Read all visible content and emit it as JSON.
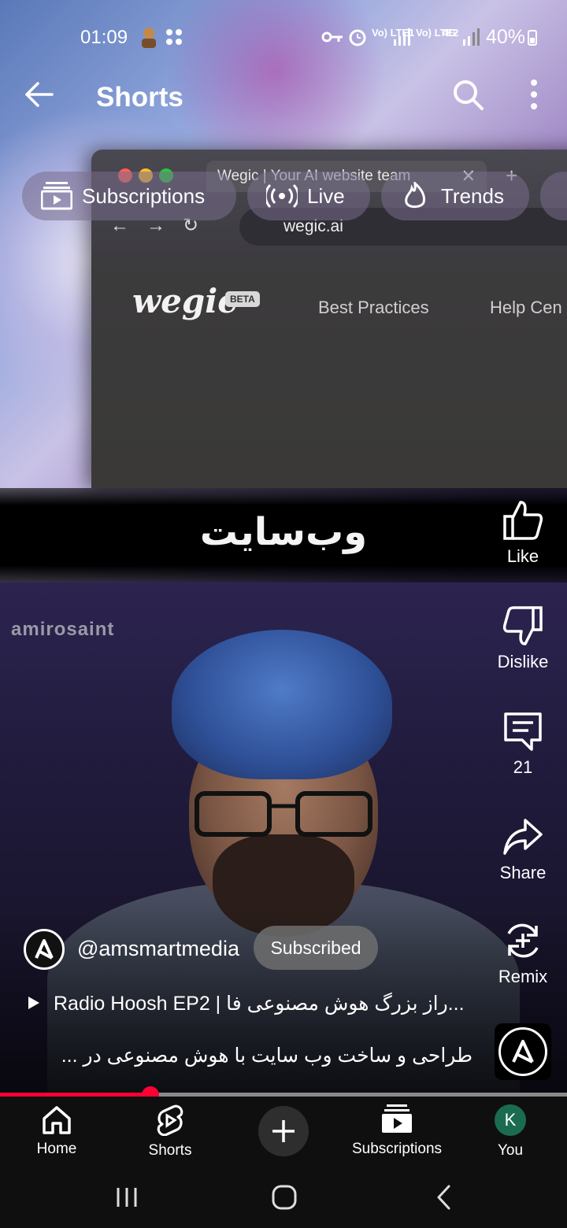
{
  "status_bar": {
    "time": "01:09",
    "network1": "Vo) LTE1",
    "network2": "Vo) LTE2",
    "network2_type": "4G",
    "battery": "40%"
  },
  "header": {
    "title": "Shorts"
  },
  "chips": [
    {
      "label": "Subscriptions",
      "icon": "subscriptions-icon"
    },
    {
      "label": "Live",
      "icon": "live-icon"
    },
    {
      "label": "Trends",
      "icon": "trends-icon"
    }
  ],
  "video": {
    "browser_tab": "Wegic | Your AI website team",
    "browser_url": "wegic.ai",
    "site_logo": "wegic",
    "site_badge": "BETA",
    "site_menu": [
      "Best Practices",
      "Help Cen"
    ],
    "caption": "وب‌سایت",
    "watermark": "amirosaint"
  },
  "actions": {
    "like": "Like",
    "dislike": "Dislike",
    "comments": "21",
    "share": "Share",
    "remix": "Remix"
  },
  "channel": {
    "handle": "@amsmartmedia",
    "subscribe_state": "Subscribed"
  },
  "video_title": "Radio Hoosh EP2 | راز بزرگ هوش مصنوعی فا...",
  "video_description": "طراحی و ساخت وب سایت با هوش مصنوعی در ...",
  "progress": 0.265,
  "bottom_nav": {
    "home": "Home",
    "shorts": "Shorts",
    "subscriptions": "Subscriptions",
    "you": "You",
    "avatar_letter": "K"
  },
  "colors": {
    "accent": "#ff0033",
    "avatar": "#1b6b51"
  }
}
